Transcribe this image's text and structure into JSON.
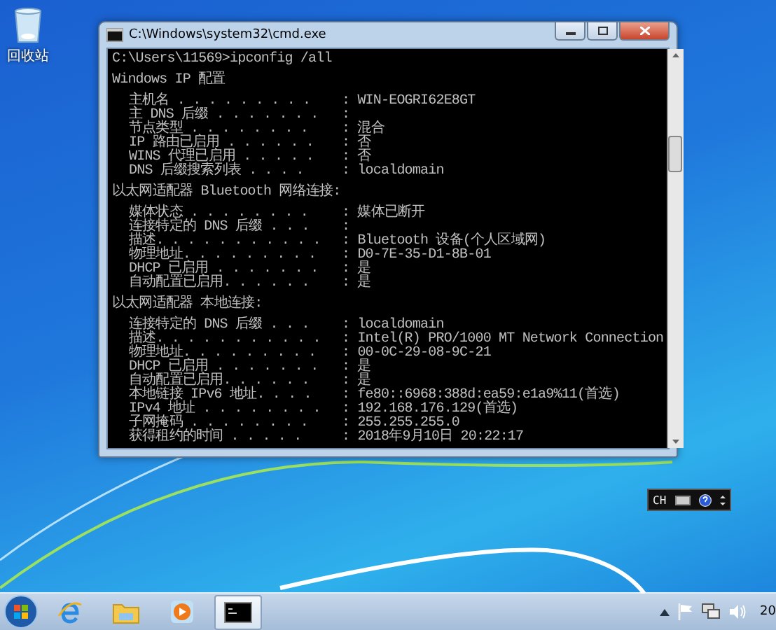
{
  "desktop_icons": [
    {
      "label": "回收站"
    }
  ],
  "window": {
    "title": "C:\\Windows\\system32\\cmd.exe"
  },
  "console": {
    "command": "C:\\Users\\11569>ipconfig /all",
    "sections": [
      {
        "heading": "Windows IP 配置",
        "rows": [
          {
            "label": "主机名  . . . . . . . . .",
            "value": ": WIN-EOGRI62E8GT"
          },
          {
            "label": "主 DNS 后缀 . . . . . . .",
            "value": ":"
          },
          {
            "label": "节点类型  . . . . . . . .",
            "value": ": 混合"
          },
          {
            "label": "IP 路由已启用 . . . . . .",
            "value": ": 否"
          },
          {
            "label": "WINS 代理已启用 . . . . .",
            "value": ": 否"
          },
          {
            "label": "DNS 后缀搜索列表  . . . .",
            "value": ": localdomain"
          }
        ]
      },
      {
        "heading": "以太网适配器 Bluetooth 网络连接:",
        "rows": [
          {
            "label": "媒体状态  . . . . . . . .",
            "value": ": 媒体已断开"
          },
          {
            "label": "连接特定的 DNS 后缀 . . .",
            "value": ":"
          },
          {
            "label": "描述. . . . . . . . . . .",
            "value": ": Bluetooth 设备(个人区域网)"
          },
          {
            "label": "物理地址. . . . . . . . .",
            "value": ": D0-7E-35-D1-8B-01"
          },
          {
            "label": "DHCP 已启用 . . . . . . .",
            "value": ": 是"
          },
          {
            "label": "自动配置已启用. . . . . .",
            "value": ": 是"
          }
        ]
      },
      {
        "heading": "以太网适配器 本地连接:",
        "rows": [
          {
            "label": "连接特定的 DNS 后缀 . . .",
            "value": ": localdomain"
          },
          {
            "label": "描述. . . . . . . . . . .",
            "value": ": Intel(R) PRO/1000 MT Network Connection"
          },
          {
            "label": "物理地址. . . . . . . . .",
            "value": ": 00-0C-29-08-9C-21"
          },
          {
            "label": "DHCP 已启用 . . . . . . .",
            "value": ": 是"
          },
          {
            "label": "自动配置已启用. . . . . .",
            "value": ": 是"
          },
          {
            "label": "本地链接 IPv6 地址. . . .",
            "value": ": fe80::6968:388d:ea59:e1a9%11(首选)"
          },
          {
            "label": "IPv4 地址 . . . . . . . .",
            "value": ": 192.168.176.129(首选)"
          },
          {
            "label": "子网掩码  . . . . . . . .",
            "value": ": 255.255.255.0"
          },
          {
            "label": "获得租约的时间  . . . . .",
            "value": ": 2018年9月10日 20:22:17"
          }
        ]
      }
    ]
  },
  "language_bar": {
    "label": "CH"
  },
  "taskbar": {
    "apps": [
      {
        "kind": "ie",
        "selected": false
      },
      {
        "kind": "folder",
        "selected": false
      },
      {
        "kind": "media",
        "selected": false
      },
      {
        "kind": "cmd",
        "selected": true
      }
    ],
    "clock": "20"
  }
}
